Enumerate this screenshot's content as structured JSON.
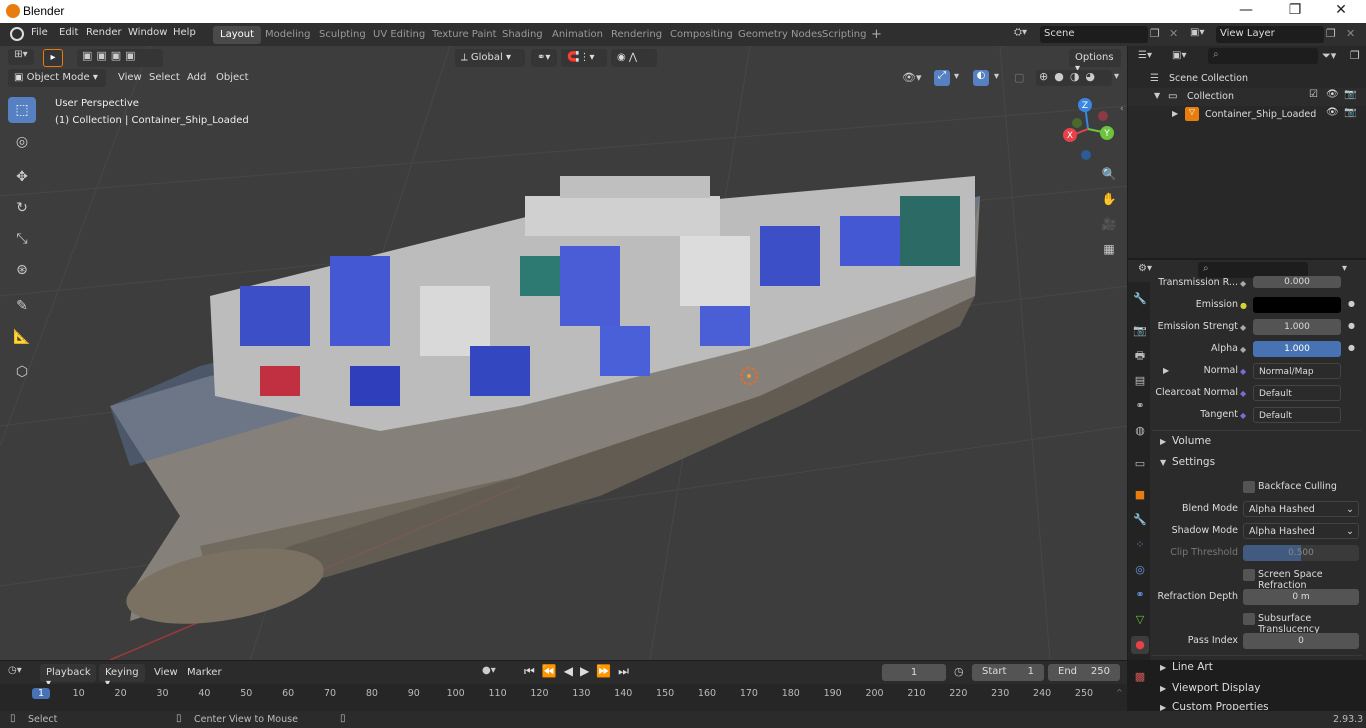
{
  "window": {
    "title": "Blender",
    "minimize": "—",
    "maximize": "❐",
    "close": "✕"
  },
  "menu": [
    "File",
    "Edit",
    "Render",
    "Window",
    "Help"
  ],
  "workspaces": [
    "Layout",
    "Modeling",
    "Sculpting",
    "UV Editing",
    "Texture Paint",
    "Shading",
    "Animation",
    "Rendering",
    "Compositing",
    "Geometry Nodes",
    "Scripting"
  ],
  "active_workspace": "Layout",
  "scene": {
    "scene_name": "Scene",
    "view_layer": "View Layer"
  },
  "viewport": {
    "mode": "Object Mode",
    "menus": [
      "View",
      "Select",
      "Add",
      "Object"
    ],
    "transform_orientation": "Global",
    "options": "Options",
    "info_line1": "User Perspective",
    "info_line2": "(1) Collection | Container_Ship_Loaded",
    "gizmo": {
      "x": "X",
      "y": "Y",
      "z": "Z"
    },
    "colors": {
      "x": "#e8414a",
      "y": "#6ec33d",
      "z": "#3b86e0"
    }
  },
  "outliner": {
    "root": "Scene Collection",
    "collection": "Collection",
    "object": "Container_Ship_Loaded"
  },
  "properties": {
    "transmission_label": "Transmission R...",
    "transmission_value": "0.000",
    "emission_label": "Emission",
    "emission_strength_label": "Emission Strengt",
    "emission_strength_value": "1.000",
    "alpha_label": "Alpha",
    "alpha_value": "1.000",
    "normal_label": "Normal",
    "normal_value": "Normal/Map",
    "clearcoat_label": "Clearcoat Normal",
    "clearcoat_value": "Default",
    "tangent_label": "Tangent",
    "tangent_value": "Default",
    "volume": "Volume",
    "settings": "Settings",
    "backface": "Backface Culling",
    "blend_mode_label": "Blend Mode",
    "blend_mode_value": "Alpha Hashed",
    "shadow_mode_label": "Shadow Mode",
    "shadow_mode_value": "Alpha Hashed",
    "clip_label": "Clip Threshold",
    "clip_value": "0.500",
    "ssr": "Screen Space Refraction",
    "refraction_depth_label": "Refraction Depth",
    "refraction_depth_value": "0 m",
    "sss": "Subsurface Translucency",
    "pass_index_label": "Pass Index",
    "pass_index_value": "0",
    "line_art": "Line Art",
    "viewport_display": "Viewport Display",
    "custom_props": "Custom Properties"
  },
  "timeline": {
    "menus": [
      "Playback",
      "Keying",
      "View",
      "Marker"
    ],
    "current_frame": "1",
    "start_label": "Start",
    "start": "1",
    "end_label": "End",
    "end": "250",
    "ticks": [
      "1",
      "10",
      "20",
      "30",
      "40",
      "50",
      "60",
      "70",
      "80",
      "90",
      "100",
      "110",
      "120",
      "130",
      "140",
      "150",
      "160",
      "170",
      "180",
      "190",
      "200",
      "210",
      "220",
      "230",
      "240",
      "250"
    ]
  },
  "status": {
    "left": "Select",
    "middle": "Center View to Mouse",
    "version": "2.93.3"
  }
}
